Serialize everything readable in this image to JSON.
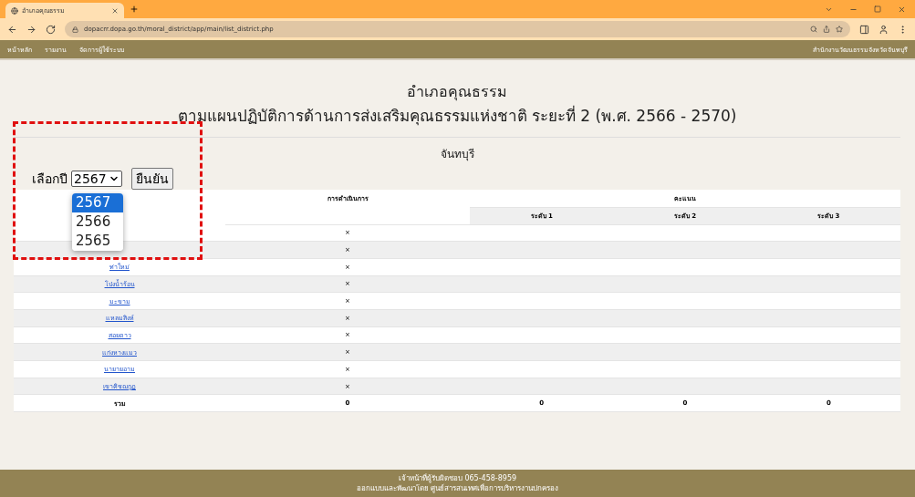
{
  "browser": {
    "tab_title": "อำเภอคุณธรรม",
    "url": "dopacrr.dopa.go.th/moral_district/app/main/list_district.php"
  },
  "nav": {
    "items": [
      "หน้าหลัก",
      "รายงาน",
      "จัดการผู้ใช้ระบบ"
    ],
    "office": "สำนักงานวัฒนธรรมจังหวัดจันทบุรี"
  },
  "heading": {
    "title": "อำเภอคุณธรรม",
    "subtitle": "ตามแผนปฏิบัติการด้านการส่งเสริมคุณธรรมแห่งชาติ ระยะที่ 2 (พ.ศ. 2566 - 2570)",
    "province": "จันทบุรี"
  },
  "year_picker": {
    "label": "เลือกปี",
    "value": "2567",
    "options": [
      {
        "label": "2567",
        "selected": true
      },
      {
        "label": "2566",
        "selected": false
      },
      {
        "label": "2565",
        "selected": false
      }
    ],
    "button": "ยืนยัน"
  },
  "table": {
    "columns": [
      "การดำเนินการ",
      "คะแนน"
    ],
    "subcolumns": [
      "ระดับ 1",
      "ระดับ 2",
      "ระดับ 3"
    ],
    "rows": [
      {
        "status": "×"
      },
      {
        "status": "×"
      },
      {
        "district": "ท่าใหม่",
        "status": "×"
      },
      {
        "district": "โป่งน้ำร้อน",
        "status": "×"
      },
      {
        "district": "มะขาม",
        "status": "×"
      },
      {
        "district": "แหลมสิงห์",
        "status": "×"
      },
      {
        "district": "สอยดาว",
        "status": "×"
      },
      {
        "district": "แก่งหางแมว",
        "status": "×"
      },
      {
        "district": "นายายอาม",
        "status": "×"
      },
      {
        "district": "เขาคิชฌกูฏ",
        "status": "×"
      }
    ],
    "total": [
      "รวม",
      "0",
      "0",
      "0",
      "0"
    ]
  },
  "footer": {
    "lines": [
      "เจ้าหน้าที่ผู้รับผิดชอบ 065-458-8959",
      "ออกแบบและพัฒนาโดย ศูนย์สารสนเทศเพื่อการบริหารงานปกครอง"
    ]
  }
}
